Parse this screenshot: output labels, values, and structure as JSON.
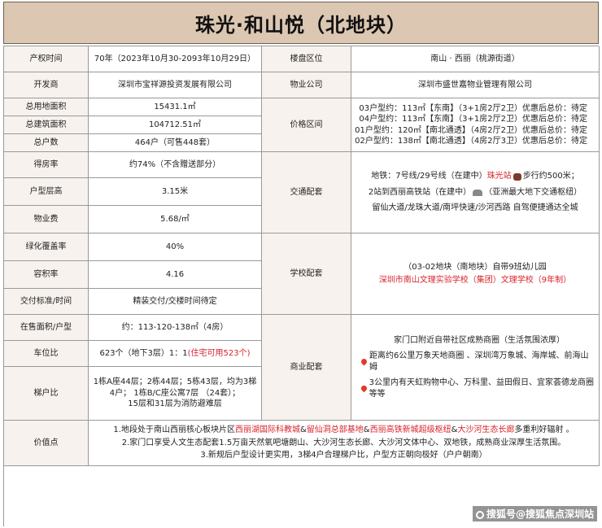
{
  "title": "珠光·和山悦（北地块）",
  "rows": {
    "property_rights": {
      "label": "产权时间",
      "value": "70年（2023年10月30-2093年10月29日）"
    },
    "location": {
      "label": "楼盘区位",
      "value": "南山 · 西丽（桃源街道）"
    },
    "developer": {
      "label": "开发商",
      "value": "深圳市宝祥源投资发展有限公司"
    },
    "property_company": {
      "label": "物业公司",
      "value": "深圳市盛世嘉物业管理有限公司"
    },
    "land_area": {
      "label": "总用地面积",
      "value": "15431.1㎡"
    },
    "building_area": {
      "label": "总建筑面积",
      "value": "104712.51㎡"
    },
    "households": {
      "label": "总户数",
      "value": "464户（可售448套）"
    },
    "price_range": {
      "label": "价格区间",
      "lines": [
        "03户型约：113㎡【东南】（3+1房2厅2卫）优惠后总价：待定",
        "04户型约：113㎡【东南】（3+1房2厅2卫）优惠后总价：待定",
        "01户型约：120㎡【南北通透】（4房2厅2卫）优惠后总价：待定",
        "02户型约：138㎡【南北通透】（4房2厅3卫）优惠后总价：待定"
      ]
    },
    "efficiency": {
      "label": "得房率",
      "value": "约74%（不含赠送部分）"
    },
    "floor_height": {
      "label": "户型层高",
      "value": "3.15米"
    },
    "property_fee": {
      "label": "物业费",
      "value": "5.68/㎡"
    },
    "traffic": {
      "label": "交通配套",
      "metro_pre": "地铁：7号线/29号线（在建中）",
      "metro_station": "珠光站",
      "metro_post": "步行约500米；",
      "rail_pre": "2站到西丽高铁站（在建中）",
      "rail_post": "（亚洲最大地下交通枢纽）",
      "roads": "留仙大道/龙珠大道/南坪快速/沙河西路 自驾便捷通达全城"
    },
    "green_rate": {
      "label": "绿化覆盖率",
      "value": "40%"
    },
    "plot_ratio": {
      "label": "容积率",
      "value": "4.16"
    },
    "school": {
      "label": "学校配套",
      "line1": "（03-02地块（南地块）自带9班幼儿园",
      "line2": "深圳市南山文理实验学校（集团）文理学校（9年制）"
    },
    "delivery": {
      "label": "交付标准/时间",
      "value": "精装交付/交楼时间待定"
    },
    "on_sale": {
      "label": "在售面积/户型",
      "value": "约：113-120-138㎡（4房）"
    },
    "parking": {
      "label": "车位比",
      "value_pre": "623个（地下3层）1：1",
      "value_red": "(住宅可用523个)"
    },
    "commerce": {
      "label": "商业配套",
      "line1": "家门口附近自带社区成熟商圈（生活氛围浓厚）",
      "line2": "距离约6公里万象天地商圈 、深圳湾万象城、海岸城、前海山姆",
      "line3": "3公里内有天虹购物中心、万科里、益田假日、宜家荟德龙商圈等等"
    },
    "elevator": {
      "label": "梯户比",
      "lines": [
        "1栋A座44层；2栋44层；5栋43层，均为3梯",
        "4户；   1栋B/C座公寓7层 （24套）；",
        "15层和31层为消防避难层"
      ]
    },
    "value_points": {
      "label": "价值点",
      "l1_a": "1.地段处于南山西丽核心板块片区",
      "l1_b": "西丽湖国际科教城",
      "l1_c": "&",
      "l1_d": "留仙洞总部基地",
      "l1_e": "&",
      "l1_f": "西丽高铁新城超级枢纽",
      "l1_g": "&",
      "l1_h": "大沙河生态长廊",
      "l1_i": "多重利好辐射 。",
      "l2": "2.家门口享受人文生态配套1.5万亩天然氧吧塘朗山、大沙河生态长廊、大沙河文体中心、双地铁，成熟商业深厚生活氛围。",
      "l3": "3.新规后户型设计更实用，3梯4户合理梯户比，户型方正朝向极好（户户朝南）"
    }
  },
  "watermark": "搜狐号@搜狐焦点深圳站"
}
